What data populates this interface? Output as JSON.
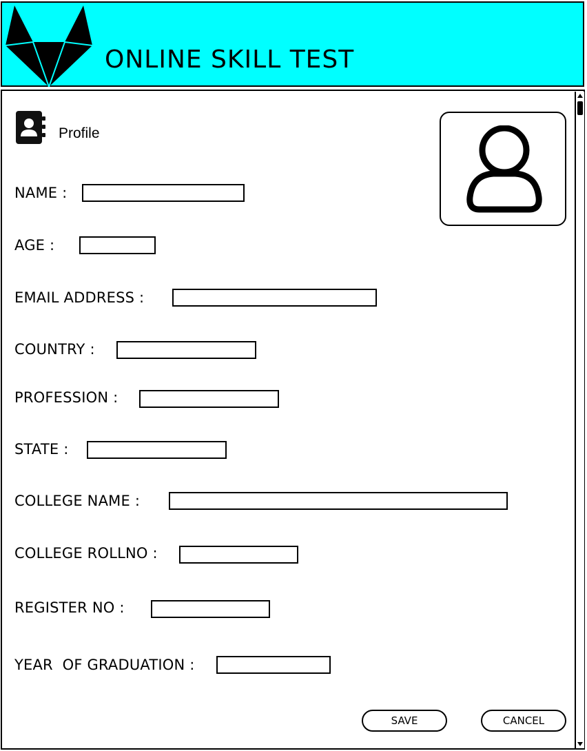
{
  "header": {
    "title": "ONLINE SKILL TEST",
    "logo_icon": "fox-logo-icon",
    "background": "#00ffff"
  },
  "profile": {
    "label": "Profile",
    "icon": "contact-book-icon",
    "avatar_icon": "user-avatar-icon"
  },
  "form": {
    "name_label": "NAME :",
    "name_value": "",
    "age_label": "AGE :",
    "age_value": "",
    "email_label": "EMAIL ADDRESS :",
    "email_value": "",
    "country_label": "COUNTRY :",
    "country_value": "",
    "profession_label": "PROFESSION :",
    "profession_value": "",
    "state_label": "STATE :",
    "state_value": "",
    "college_name_label": "COLLEGE NAME :",
    "college_name_value": "",
    "college_rollno_label": "COLLEGE ROLLNO :",
    "college_rollno_value": "",
    "register_no_label": "REGISTER NO :",
    "register_no_value": "",
    "year_graduation_label": "YEAR  OF GRADUATION :",
    "year_graduation_value": ""
  },
  "actions": {
    "save_label": "SAVE",
    "cancel_label": "CANCEL"
  }
}
